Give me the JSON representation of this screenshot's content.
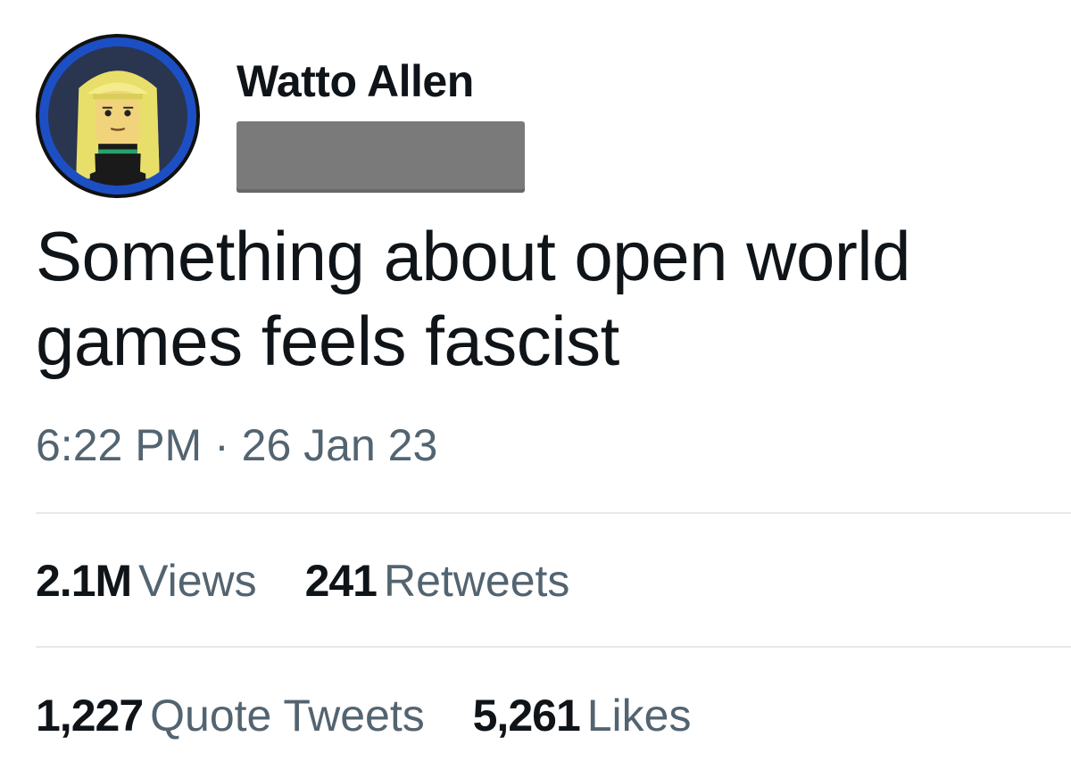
{
  "author": {
    "display_name": "Watto Allen",
    "avatar_icon": "lego-minifigure-avatar-icon",
    "handle_redacted": true
  },
  "tweet": {
    "text_line1": "Something about open world",
    "text_line2": "games feels fascist",
    "timestamp": "6:22 PM · 26 Jan 23"
  },
  "stats": {
    "views": {
      "value": "2.1M",
      "label": "Views"
    },
    "retweets": {
      "value": "241",
      "label": "Retweets"
    },
    "quote_tweets": {
      "value": "1,227",
      "label": "Quote Tweets"
    },
    "likes": {
      "value": "5,261",
      "label": "Likes"
    }
  },
  "colors": {
    "primary_text": "#0f1419",
    "secondary_text": "#536471",
    "divider": "#e6eaed",
    "avatar_ring": "#1d4fc4",
    "redaction": "#7a7a7a"
  }
}
